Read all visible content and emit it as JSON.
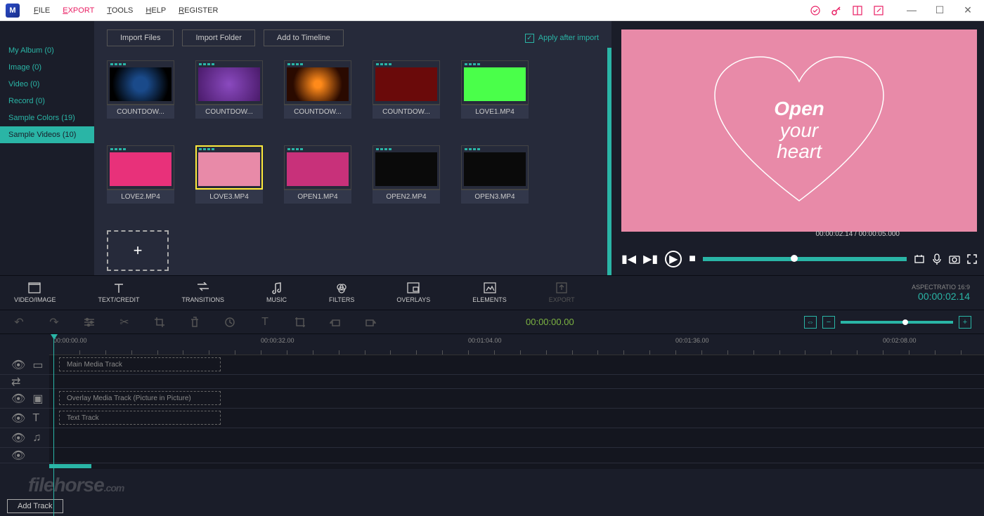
{
  "menu": {
    "file": "FILE",
    "export": "EXPORT",
    "tools": "TOOLS",
    "help": "HELP",
    "register": "REGISTER"
  },
  "sidebar": {
    "items": [
      {
        "label": "My Album (0)"
      },
      {
        "label": "Image (0)"
      },
      {
        "label": "Video (0)"
      },
      {
        "label": "Record (0)"
      },
      {
        "label": "Sample Colors (19)"
      },
      {
        "label": "Sample Videos (10)"
      }
    ]
  },
  "toolbar": {
    "import_files": "Import Files",
    "import_folder": "Import Folder",
    "add_timeline": "Add to Timeline",
    "apply_after_import": "Apply after import"
  },
  "media": [
    {
      "label": "COUNTDOW...",
      "thumb": "t-countdown1"
    },
    {
      "label": "COUNTDOW...",
      "thumb": "t-countdown2"
    },
    {
      "label": "COUNTDOW...",
      "thumb": "t-countdown3"
    },
    {
      "label": "COUNTDOW...",
      "thumb": "t-countdown4"
    },
    {
      "label": "LOVE1.MP4",
      "thumb": "t-love1"
    },
    {
      "label": "LOVE2.MP4",
      "thumb": "t-love2"
    },
    {
      "label": "LOVE3.MP4",
      "thumb": "t-love3",
      "selected": true
    },
    {
      "label": "OPEN1.MP4",
      "thumb": "t-open1"
    },
    {
      "label": "OPEN2.MP4",
      "thumb": "t-open2"
    },
    {
      "label": "OPEN3.MP4",
      "thumb": "t-open3"
    }
  ],
  "preview": {
    "text_line1": "Open",
    "text_line2": "your",
    "text_line3": "heart",
    "time_current": "00:00:02.14",
    "time_total": "00:00:05.000",
    "seek_percent": 43
  },
  "modules": {
    "video_image": "VIDEO/IMAGE",
    "text_credit": "TEXT/CREDIT",
    "transitions": "TRANSITIONS",
    "music": "MUSIC",
    "filters": "FILTERS",
    "overlays": "OVERLAYS",
    "elements": "ELEMENTS",
    "export": "EXPORT"
  },
  "aspect": {
    "label": "ASPECTRATIO 16:9",
    "timecode": "00:00:02.14"
  },
  "timeline": {
    "center_timecode": "00:00:00.00",
    "ruler": [
      "00:00:00.00",
      "00:00:32.00",
      "00:01:04.00",
      "00:01:36.00",
      "00:02:08.00"
    ],
    "tracks": {
      "main": "Main Media Track",
      "overlay": "Overlay Media Track (Picture in Picture)",
      "text": "Text Track"
    },
    "add_track": "Add Track",
    "zoom_percent": 55
  },
  "watermark": {
    "name": "filehorse",
    "suffix": ".com"
  }
}
